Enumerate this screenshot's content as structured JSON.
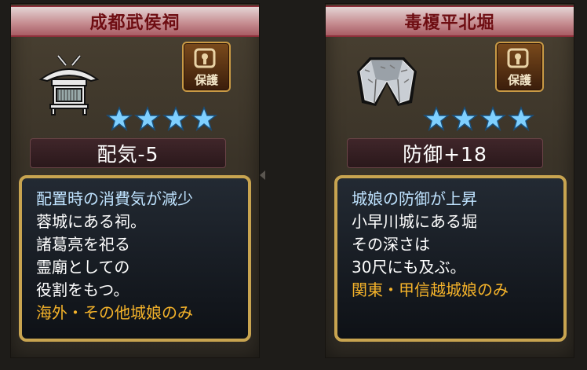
{
  "cards": [
    {
      "title": "成都武侯祠",
      "icon": "shrine-icon",
      "protect_label": "保護",
      "stars": 4,
      "stat": "配気-5",
      "effect": "配置時の消費気が減少",
      "lines": [
        "蓉城にある祠。",
        "諸葛亮を祀る",
        "霊廟としての",
        "役割をもつ。"
      ],
      "restriction": "海外・その他城娘のみ"
    },
    {
      "title": "毒榎平北堀",
      "icon": "moat-icon",
      "protect_label": "保護",
      "stars": 4,
      "stat": "防御+18",
      "effect": "城娘の防御が上昇",
      "lines": [
        "小早川城にある堀",
        "その深さは",
        "30尺にも及ぶ。"
      ],
      "restriction": "関東・甲信越城娘のみ"
    }
  ],
  "colors": {
    "title_text": "#6e0d12",
    "effect_text": "#bfe3ff",
    "restriction_text": "#f5b32a",
    "frame_gold": "#c8a450",
    "star_blue": "#7fd0ff"
  }
}
